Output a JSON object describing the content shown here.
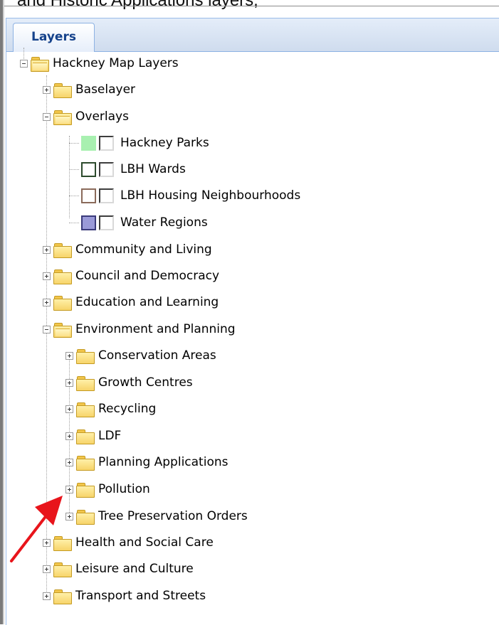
{
  "caption": "and Historic Applications layers,",
  "panel": {
    "tab_label": "Layers"
  },
  "tree": {
    "root": "Hackney Map Layers",
    "baselayer": "Baselayer",
    "overlays": {
      "label": "Overlays",
      "items": [
        {
          "label": "Hackney Parks",
          "swatch_fill": "#a8f0b0",
          "swatch_border": "#a8f0b0"
        },
        {
          "label": "LBH Wards",
          "swatch_fill": "#ffffff",
          "swatch_border": "#2c4a2c"
        },
        {
          "label": "LBH Housing Neighbourhoods",
          "swatch_fill": "#ffffff",
          "swatch_border": "#8a6a5a"
        },
        {
          "label": "Water Regions",
          "swatch_fill": "#9a9ad8",
          "swatch_border": "#3a3a7a"
        }
      ]
    },
    "community": "Community and Living",
    "council": "Council and Democracy",
    "education": "Education and Learning",
    "environment": {
      "label": "Environment and Planning",
      "children": [
        "Conservation Areas",
        "Growth Centres",
        "Recycling",
        "LDF",
        "Planning Applications",
        "Pollution",
        "Tree Preservation Orders"
      ]
    },
    "health": "Health and Social Care",
    "leisure": "Leisure and Culture",
    "transport": "Transport and Streets"
  },
  "colors": {
    "annotation_arrow": "#e8141b",
    "tab_text": "#15428b"
  }
}
